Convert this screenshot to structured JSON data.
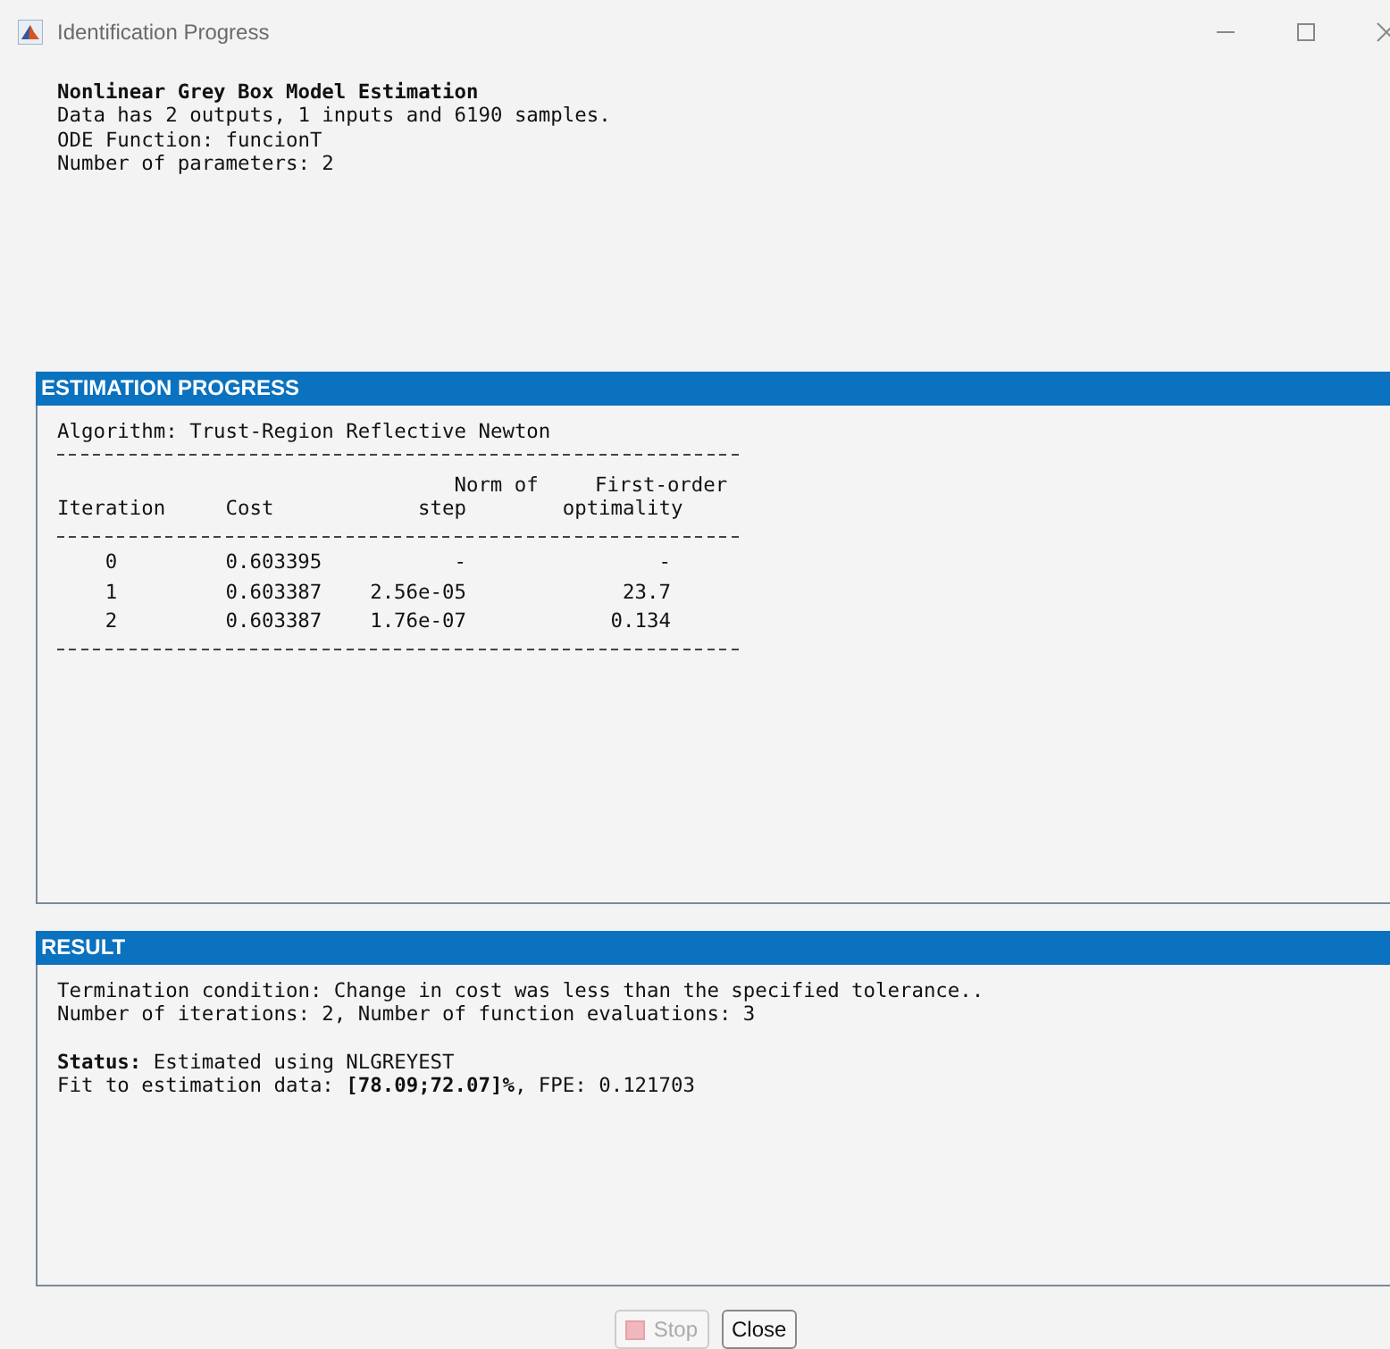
{
  "window": {
    "title": "Identification Progress"
  },
  "summary": {
    "heading": "Nonlinear Grey Box Model Estimation",
    "lines": [
      "Data has 2 outputs, 1 inputs and 6190 samples.",
      "ODE Function: funcionT",
      "Number of parameters: 2"
    ]
  },
  "estimation": {
    "title": "ESTIMATION PROGRESS",
    "algorithm": "Algorithm: Trust-Region Reflective Newton",
    "table": {
      "columns": [
        {
          "label": "Iteration"
        },
        {
          "label": "Cost"
        },
        {
          "top": "Norm of",
          "label": "step"
        },
        {
          "top": "First-order",
          "label": "optimality"
        }
      ],
      "rows": [
        [
          "0",
          "0.603395",
          "-",
          "-"
        ],
        [
          "1",
          "0.603387",
          "2.56e-05",
          "23.7"
        ],
        [
          "2",
          "0.603387",
          "1.76e-07",
          "0.134"
        ]
      ]
    }
  },
  "result": {
    "title": "RESULT",
    "paragraphs": [
      [
        "Termination condition: Change in cost was less than the specified tolerance..",
        "Number of iterations: 2, Number of function evaluations: 3"
      ],
      [
        "**Status:** Estimated using NLGREYEST",
        "Fit to estimation data: **[78.09;72.07]%**, FPE: 0.121703"
      ]
    ]
  },
  "buttons": [
    {
      "label": "Stop",
      "kind": "stop",
      "disabled": true
    },
    {
      "label": "Close",
      "kind": "plain",
      "disabled": false
    }
  ]
}
